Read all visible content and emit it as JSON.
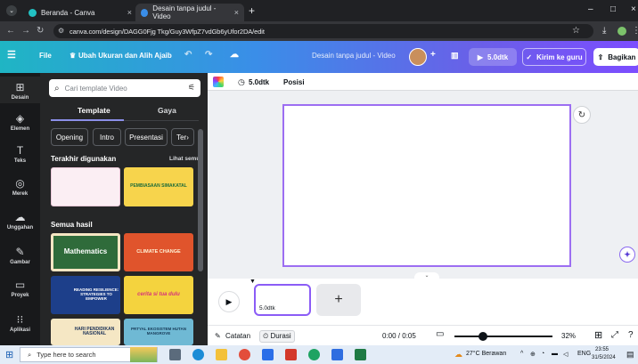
{
  "browser": {
    "tabs": [
      {
        "title": "Beranda - Canva",
        "active": false
      },
      {
        "title": "Desain tanpa judul - Video",
        "active": true
      }
    ],
    "new_tab_symbol": "+",
    "tab_close_symbol": "×",
    "url": "canva.com/design/DAGG0Fjg Tkg/Guy3WfpZ7vdGb6yUfor2DA/edit",
    "window_controls": [
      "–",
      "□",
      "×"
    ]
  },
  "canva_header": {
    "menu_icon": "hamburger-icon",
    "file_label": "File",
    "resize_label": "Ubah Ukuran dan Alih Ajaib",
    "design_title": "Desain tanpa judul - Video",
    "duration_label": "5.0dtk",
    "share_label": "Kirim ke guru",
    "export_label": "Bagikan",
    "add_symbol": "+"
  },
  "rail": {
    "items": [
      {
        "label": "Desain",
        "icon": "layout-icon",
        "glyph": "⊞"
      },
      {
        "label": "Elemen",
        "icon": "shapes-icon",
        "glyph": "◈"
      },
      {
        "label": "Teks",
        "icon": "text-icon",
        "glyph": "T"
      },
      {
        "label": "Merek",
        "icon": "brand-icon",
        "glyph": "◎"
      },
      {
        "label": "Unggahan",
        "icon": "upload-icon",
        "glyph": "☁"
      },
      {
        "label": "Gambar",
        "icon": "draw-icon",
        "glyph": "✎"
      },
      {
        "label": "Proyek",
        "icon": "folder-icon",
        "glyph": "▭"
      },
      {
        "label": "Aplikasi",
        "icon": "apps-icon",
        "glyph": "⁝⁝"
      }
    ]
  },
  "panel": {
    "search_placeholder": "Cari template Video",
    "tabs": [
      "Template",
      "Gaya"
    ],
    "chips": [
      "Opening",
      "Intro",
      "Presentasi",
      "Ter"
    ],
    "recent_title": "Terakhir digunakan",
    "see_all": "Lihat semua",
    "all_results": "Semua hasil",
    "thumbnails": [
      {
        "text": "",
        "bg": "#fbeef3",
        "color": "#c2407a"
      },
      {
        "text": "PEMBIASAAN SIMAKATAL",
        "bg": "#f7d44c",
        "color": "#1b6b3a"
      },
      {
        "text": "Mathematics",
        "bg": "#2f6b3a",
        "color": "#ffffff"
      },
      {
        "text": "CLIMATE CHANGE",
        "bg": "#e0542c",
        "color": "#fff3d6"
      },
      {
        "text": "READING RESILIENCE: STRATEGIES TO EMPOWER",
        "bg": "#1d3f8a",
        "color": "#ffffff"
      },
      {
        "text": "cerita si tua dulu",
        "bg": "#f4d33e",
        "color": "#d6337a"
      },
      {
        "text": "HARI PENDIDIKAN NASIONAL",
        "bg": "#f5e7c4",
        "color": "#1d3358"
      },
      {
        "text": "PRTYAL EKOSISTEM HUTAN MANGROVE",
        "bg": "#6fb9d4",
        "color": "#173a57"
      }
    ]
  },
  "editor": {
    "toolbar_duration": "5.0dtk",
    "toolbar_position": "Posisi",
    "clip_duration": "5.0dtk",
    "notes_label": "Catatan",
    "duration_toggle": "Durasi",
    "time_readout": "0:00 / 0:05",
    "zoom_percent": "32%",
    "zoom_level": 0.32
  },
  "taskbar": {
    "search_placeholder": "Type here to search",
    "weather": "27°C Berawan",
    "language": "ENG",
    "time": "23:55",
    "date": "31/5/2024"
  }
}
